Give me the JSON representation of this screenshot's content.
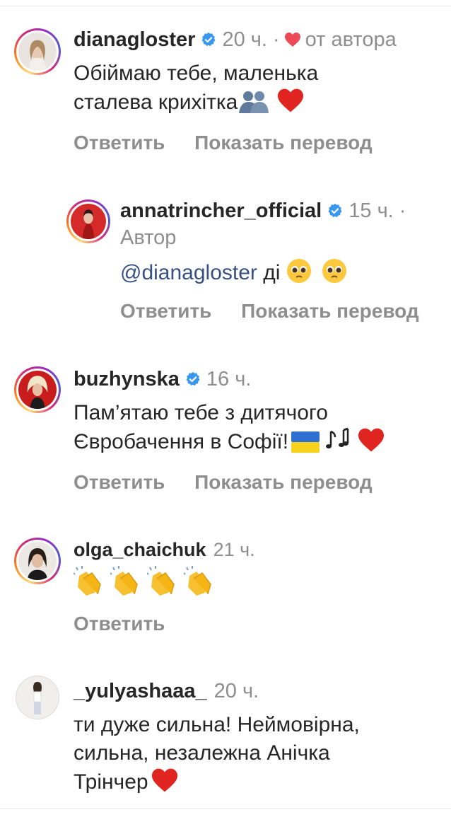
{
  "comments": [
    {
      "username": "dianagloster",
      "time": "20 ч.",
      "liked_by_author_label": "от автора",
      "text_line1": "Обіймаю тебе, маленька",
      "text_line2": "сталева крихітка",
      "reply_label": "Ответить",
      "translate_label": "Показать перевод"
    },
    {
      "username": "annatrincher_official",
      "time": "15 ч.",
      "author_label": "Автор",
      "mention": "@dianagloster",
      "text": " ді",
      "reply_label": "Ответить",
      "translate_label": "Показать перевод"
    },
    {
      "username": "buzhynska",
      "time": "16 ч.",
      "text_line1": "Пам’ятаю тебе з дитячого",
      "text_line2": "Євробачення в Софії!",
      "reply_label": "Ответить",
      "translate_label": "Показать перевод"
    },
    {
      "username": "olga_chaichuk",
      "time": "21 ч.",
      "reply_label": "Ответить"
    },
    {
      "username": "_yulyashaaa_",
      "time": "20 ч.",
      "text_line1": "ти дуже сильна! Неймовірна,",
      "text_line2": "сильна, незалежна Анічка",
      "text_line3": "Трінчер"
    }
  ],
  "colors": {
    "verified": "#3897f0",
    "heart": "#ed4956",
    "meta": "#8e8e8e",
    "mention": "#385185"
  },
  "icons": {
    "verified": "verified-badge-icon",
    "heart": "heart-icon",
    "separator": "dot-separator"
  }
}
